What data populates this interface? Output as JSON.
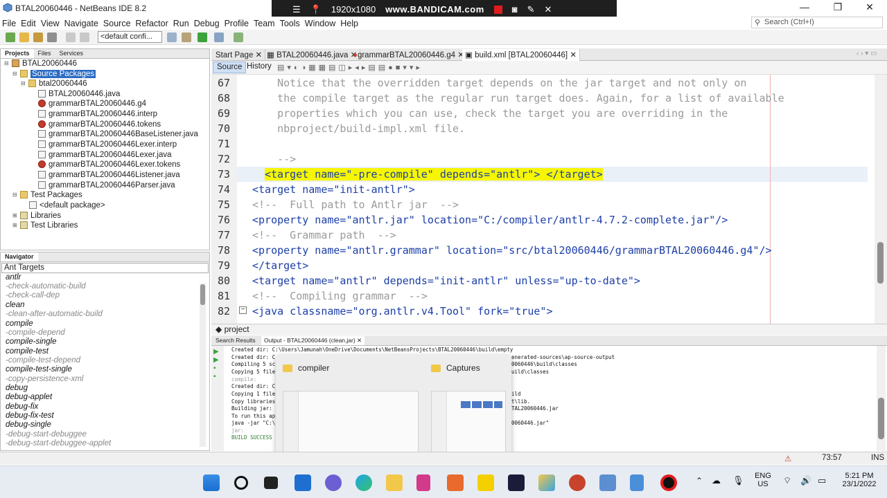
{
  "window": {
    "title": "BTAL20060446 - NetBeans IDE 8.2"
  },
  "recorder": {
    "resolution": "1920x1080",
    "brand": "www.BANDICAM.com"
  },
  "menu": [
    "File",
    "Edit",
    "View",
    "Navigate",
    "Source",
    "Refactor",
    "Run",
    "Debug",
    "Profile",
    "Team",
    "Tools",
    "Window",
    "Help"
  ],
  "search": {
    "placeholder": "Search (Ctrl+I)"
  },
  "toolbar": {
    "config": "<default confi..."
  },
  "projects_panel": {
    "tabs": [
      "Projects",
      "Files",
      "Services"
    ],
    "tree": [
      "BTAL20060446",
      "Source Packages",
      "btal20060446",
      "BTAL20060446.java",
      "grammarBTAL20060446.g4",
      "grammarBTAL20060446.interp",
      "grammarBTAL20060446.tokens",
      "grammarBTAL20060446BaseListener.java",
      "grammarBTAL20060446Lexer.interp",
      "grammarBTAL20060446Lexer.java",
      "grammarBTAL20060446Lexer.tokens",
      "grammarBTAL20060446Listener.java",
      "grammarBTAL20060446Parser.java",
      "Test Packages",
      "<default package>",
      "Libraries",
      "Test Libraries"
    ]
  },
  "navigator": {
    "title": "Navigator",
    "selector": "Ant Targets",
    "items": [
      "antlr",
      "-check-automatic-build",
      "-check-call-dep",
      "clean",
      "-clean-after-automatic-build",
      "compile",
      "-compile-depend",
      "compile-single",
      "compile-test",
      "-compile-test-depend",
      "compile-test-single",
      "-copy-persistence-xml",
      "debug",
      "debug-applet",
      "debug-fix",
      "debug-fix-test",
      "debug-single",
      "-debug-start-debuggee",
      "-debug-start-debuggee-applet"
    ]
  },
  "editor": {
    "tabs": [
      "Start Page",
      "BTAL20060446.java",
      "grammarBTAL20060446.g4",
      "build.xml [BTAL20060446]"
    ],
    "source_label": "Source",
    "history_label": "History",
    "line_numbers": [
      "67",
      "68",
      "69",
      "70",
      "71",
      "72",
      "73",
      "74",
      "75",
      "76",
      "77",
      "78",
      "79",
      "80",
      "81",
      "82"
    ],
    "lines": [
      "    Notice that the overridden target depends on the jar target and not only on",
      "    the compile target as the regular run target does. Again, for a list of available",
      "    properties which you can use, check the target you are overriding in the",
      "    nbproject/build-impl.xml file.",
      "",
      "    -->",
      "<target name=\"-pre-compile\" depends=\"antlr\"> </target>",
      "<target name=\"init-antlr\">",
      "<!--  Full path to Antlr jar  -->",
      "<property name=\"antlr.jar\" location=\"C:/compiler/antlr-4.7.2-complete.jar\"/>",
      "<!--  Grammar path  -->",
      "<property name=\"antlr.grammar\" location=\"src/btal20060446/grammarBTAL20060446.g4\"/>",
      "</target>",
      "<target name=\"antlr\" depends=\"init-antlr\" unless=\"up-to-date\">",
      "<!--  Compiling grammar  -->",
      "<java classname=\"org.antlr.v4.Tool\" fork=\"true\">"
    ],
    "breadcrumb": "project"
  },
  "output": {
    "tabs": [
      "Search Results",
      "Output - BTAL20060446 (clean,jar)"
    ],
    "left_lines": [
      "Created dir: C:\\Users\\Jamunah\\OneDrive\\Documents\\NetBeansProjects\\BTAL20060446\\build\\empty",
      "Created dir: C",
      "Compiling 5 sc",
      "Copying 5 file",
      "compile:",
      "Created dir: C",
      "Copying 1 file",
      "Copy libraries",
      "Building jar:",
      "To run this ap",
      "java -jar \"C:\\",
      "jar:",
      "BUILD SUCCESS"
    ],
    "right_lines": [
      "enerated-sources\\ap-source-output",
      "0060446\\build\\classes",
      "uild\\classes",
      "",
      "",
      "ild",
      "t\\lib.",
      "TAL20060446.jar",
      "",
      "0060446.jar\""
    ]
  },
  "popup": {
    "left_title": "compiler",
    "right_title": "Captures"
  },
  "status": {
    "position": "73:57",
    "mode": "INS"
  },
  "taskbar": {
    "lang_top": "ENG",
    "lang_bottom": "US",
    "time": "5:21 PM",
    "date": "23/1/2022"
  },
  "colors": {
    "accent": "#2b6cc4",
    "highlight": "#f6f600",
    "tag": "#1b3ea8",
    "value": "#c87000",
    "comment": "#9a9a9a"
  }
}
